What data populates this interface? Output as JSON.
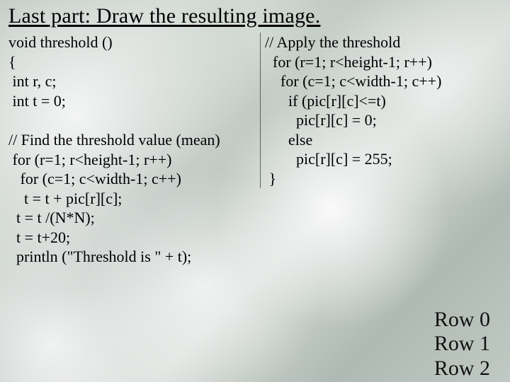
{
  "title": "Last part: Draw the resulting image.",
  "code_left_block1": "void threshold ()\n{\n int r, c;\n int t = 0;",
  "code_left_block2": "// Find the threshold value (mean)\n for (r=1; r<height-1; r++)\n   for (c=1; c<width-1; c++)\n    t = t + pic[r][c];\n  t = t /(N*N);\n  t = t+20;\n  println (\"Threshold is \" + t);",
  "code_right": "// Apply the threshold\n  for (r=1; r<height-1; r++)\n    for (c=1; c<width-1; c++)\n      if (pic[r][c]<=t)\n        pic[r][c] = 0;\n      else\n        pic[r][c] = 255;\n }",
  "rows": {
    "r0": "Row 0",
    "r1": "Row 1",
    "r2": "Row 2"
  }
}
